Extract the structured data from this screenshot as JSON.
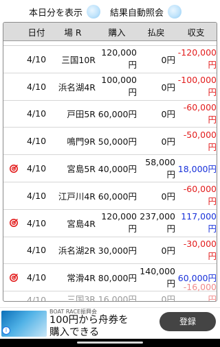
{
  "top": {
    "show_today_label": "本日分を表示",
    "auto_inquiry_label": "結果自動照会"
  },
  "table": {
    "headers": [
      "日付",
      "場 R",
      "購入",
      "払戻",
      "収支"
    ],
    "rows": [
      {
        "date": "4/10",
        "venue": "三国10R",
        "purchase": "120,000円",
        "payout": "0円",
        "balance": "-120,000円",
        "sign": "neg",
        "hit": false
      },
      {
        "date": "4/10",
        "venue": "浜名湖4R",
        "purchase": "100,000円",
        "payout": "0円",
        "balance": "-100,000円",
        "sign": "neg",
        "hit": false
      },
      {
        "date": "4/10",
        "venue": "戸田5R",
        "purchase": "60,000円",
        "payout": "0円",
        "balance": "-60,000円",
        "sign": "neg",
        "hit": false
      },
      {
        "date": "4/10",
        "venue": "鳴門9R",
        "purchase": "50,000円",
        "payout": "0円",
        "balance": "-50,000円",
        "sign": "neg",
        "hit": false
      },
      {
        "date": "4/10",
        "venue": "宮島5R",
        "purchase": "40,000円",
        "payout": "58,000円",
        "balance": "18,000円",
        "sign": "pos",
        "hit": true
      },
      {
        "date": "4/10",
        "venue": "江戸川4R",
        "purchase": "60,000円",
        "payout": "0円",
        "balance": "-60,000円",
        "sign": "neg",
        "hit": false
      },
      {
        "date": "4/10",
        "venue": "宮島4R",
        "purchase": "120,000円",
        "payout": "237,000円",
        "balance": "117,000円",
        "sign": "pos",
        "hit": true
      },
      {
        "date": "4/10",
        "venue": "浜名湖2R",
        "purchase": "30,000円",
        "payout": "0円",
        "balance": "-30,000円",
        "sign": "neg",
        "hit": false
      },
      {
        "date": "4/10",
        "venue": "常滑4R",
        "purchase": "80,000円",
        "payout": "140,000円",
        "balance": "60,000円",
        "sign": "pos",
        "hit": true
      }
    ]
  },
  "ad": {
    "source": "BOAT RACE振興会",
    "line1": "100円から舟券を",
    "line2": "購入できる",
    "button": "登録",
    "info_icon": "info-icon"
  },
  "icons": {
    "hit": "target-icon",
    "accent_neg": "#e21b1b",
    "accent_pos": "#1730d9"
  }
}
